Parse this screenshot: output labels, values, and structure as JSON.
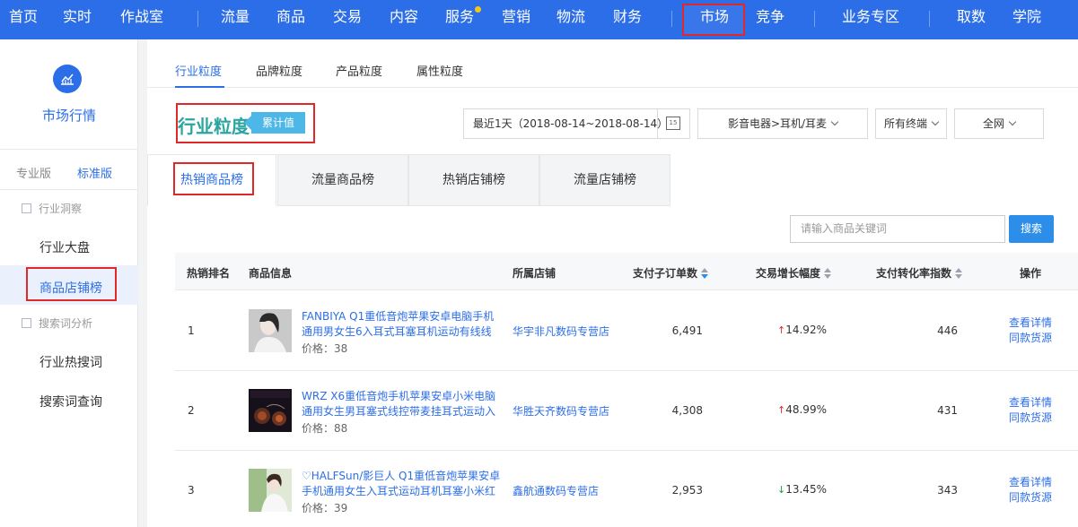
{
  "topnav": {
    "items": [
      "首页",
      "实时",
      "作战室",
      "流量",
      "商品",
      "交易",
      "内容",
      "服务",
      "营销",
      "物流",
      "财务",
      "市场",
      "竞争",
      "业务专区",
      "取数",
      "学院"
    ],
    "active": "市场"
  },
  "sidebar": {
    "title": "市场行情",
    "versions": {
      "pro": "专业版",
      "standard": "标准版"
    },
    "sections": [
      {
        "label": "行业洞察",
        "items": [
          "行业大盘",
          "商品店铺榜"
        ]
      },
      {
        "label": "搜索词分析",
        "items": [
          "行业热搜词",
          "搜索词查询"
        ]
      }
    ],
    "active_item": "商品店铺榜"
  },
  "subtabs": [
    "行业粒度",
    "品牌粒度",
    "产品粒度",
    "属性粒度"
  ],
  "page": {
    "title": "行业粒度",
    "badge": "累计值"
  },
  "filters": {
    "date": "最近1天（2018-08-14~2018-08-14）",
    "calendar_day": "15",
    "category": "影音电器>耳机/耳麦",
    "terminal": "所有终端",
    "network": "全网"
  },
  "ranktabs": [
    "热销商品榜",
    "流量商品榜",
    "热销店铺榜",
    "流量店铺榜"
  ],
  "search": {
    "placeholder": "请输入商品关键词",
    "button": "搜索"
  },
  "table": {
    "headers": {
      "rank": "热销排名",
      "info": "商品信息",
      "shop": "所属店铺",
      "orders": "支付子订单数",
      "growth": "交易增长幅度",
      "conversion": "支付转化率指数",
      "action": "操作"
    },
    "rows": [
      {
        "rank": "1",
        "name1": "FANBIYA Q1重低音炮苹果安卓电脑手机",
        "name2": "通用男女生6入耳式耳塞耳机运动有线线",
        "price": "价格：38",
        "shop": "华宇非凡数码专营店",
        "orders": "6,491",
        "growth": "14.92%",
        "growth_dir": "up",
        "conversion": "446",
        "action1": "查看详情",
        "action2": "同款货源"
      },
      {
        "rank": "2",
        "name1": "WRZ X6重低音炮手机苹果安卓小米电脑",
        "name2": "通用女生男耳塞式线控带麦挂耳式运动入",
        "price": "价格：88",
        "shop": "华胜天齐数码专营店",
        "orders": "4,308",
        "growth": "48.99%",
        "growth_dir": "up",
        "conversion": "431",
        "action1": "查看详情",
        "action2": "同款货源"
      },
      {
        "rank": "3",
        "name1": "♡HALFSun/影巨人 Q1重低音炮苹果安卓",
        "name2": "手机通用女生入耳式运动耳机耳塞小米红",
        "price": "价格：39",
        "shop": "鑫航通数码专营店",
        "orders": "2,953",
        "growth": "13.45%",
        "growth_dir": "down",
        "conversion": "343",
        "action1": "查看详情",
        "action2": "同款货源"
      }
    ]
  }
}
